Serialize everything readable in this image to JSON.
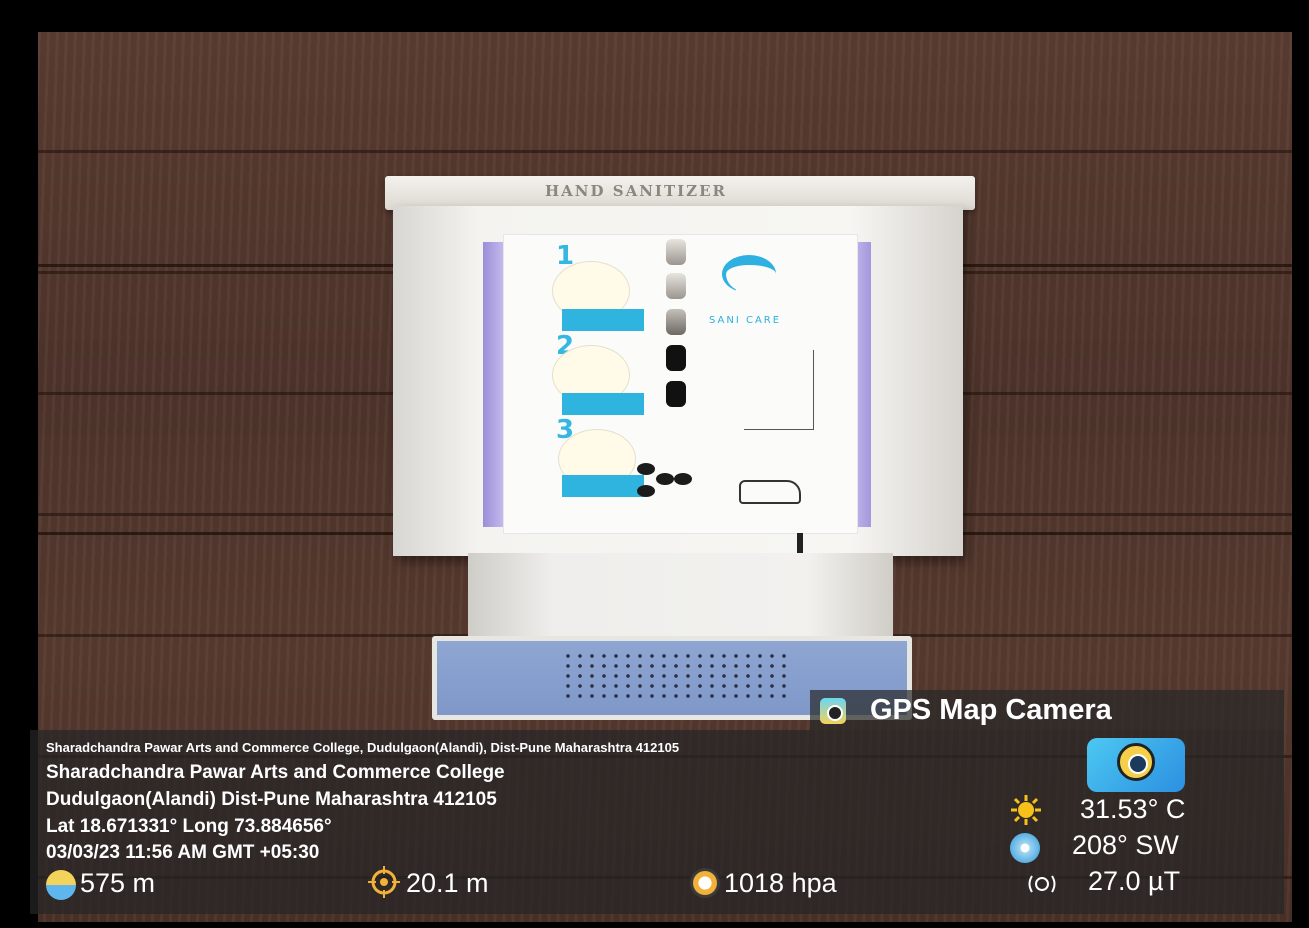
{
  "dispenser": {
    "lid_label": "HAND SANITIZER",
    "brand": "SANI CARE",
    "steps": [
      "1",
      "2",
      "3"
    ]
  },
  "overlay": {
    "app_name": "GPS Map Camera",
    "address_small": "Sharadchandra Pawar Arts and Commerce College, Dudulgaon(Alandi), Dist-Pune Maharashtra 412105",
    "place_name": "Sharadchandra Pawar Arts and Commerce College",
    "address_line": "Dudulgaon(Alandi) Dist-Pune Maharashtra 412105",
    "lat_long": "Lat 18.671331° Long 73.884656°",
    "datetime": "03/03/23 11:56 AM GMT +05:30",
    "altitude": "575 m",
    "accuracy": "20.1 m",
    "pressure": "1018 hpa",
    "temperature": "31.53° C",
    "wind": "208° SW",
    "magnetic": "27.0 µT"
  },
  "icons": {
    "app": "camera-app-icon",
    "temperature": "sun-icon",
    "wind": "wind-compass-icon",
    "magnetic": "magnet-icon",
    "altitude": "altitude-icon",
    "accuracy": "target-icon",
    "pressure": "gauge-icon"
  },
  "colors": {
    "wall": "#533830",
    "accent_blue": "#2eb0e0",
    "purple_strip": "#b7abea",
    "overlay_bg": "#262626"
  }
}
